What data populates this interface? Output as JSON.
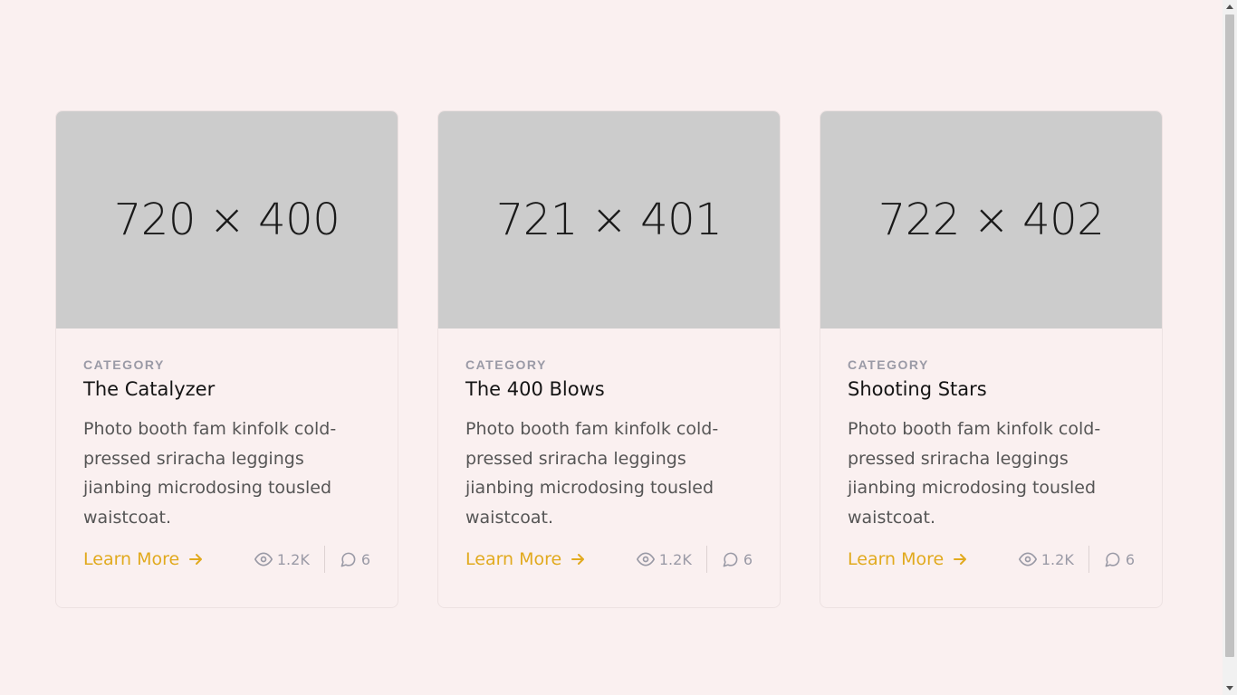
{
  "cards": [
    {
      "image_label": "720 × 400",
      "category": "CATEGORY",
      "title": "The Catalyzer",
      "description": "Photo booth fam kinfolk cold-pressed sriracha leggings jianbing microdosing tousled waistcoat.",
      "link_label": "Learn More",
      "views": "1.2K",
      "comments": "6"
    },
    {
      "image_label": "721 × 401",
      "category": "CATEGORY",
      "title": "The 400 Blows",
      "description": "Photo booth fam kinfolk cold-pressed sriracha leggings jianbing microdosing tousled waistcoat.",
      "link_label": "Learn More",
      "views": "1.2K",
      "comments": "6"
    },
    {
      "image_label": "722 × 402",
      "category": "CATEGORY",
      "title": "Shooting Stars",
      "description": "Photo booth fam kinfolk cold-pressed sriracha leggings jianbing microdosing tousled waistcoat.",
      "link_label": "Learn More",
      "views": "1.2K",
      "comments": "6"
    }
  ],
  "colors": {
    "background": "#faf0f0",
    "accent": "#e1aa1e",
    "placeholder": "#cccccc",
    "muted": "#9a9aa6"
  },
  "icons": {
    "link_arrow": "arrow-right-icon",
    "views": "eye-icon",
    "comments": "comment-bubble-icon"
  }
}
